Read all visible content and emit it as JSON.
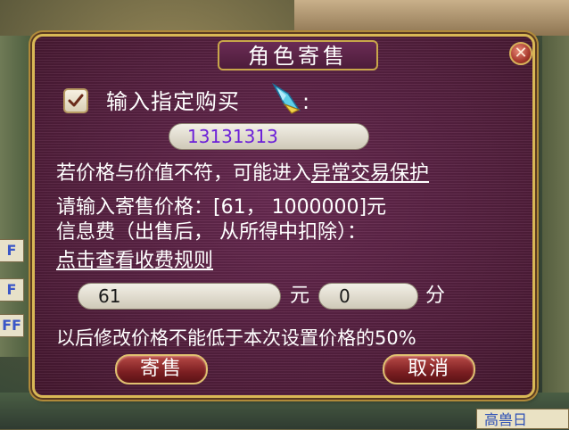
{
  "dialog": {
    "title": "角色寄售",
    "close_glyph": "✕",
    "buyer_checkbox_checked": true,
    "buyer_label": "输入指定购买",
    "buyer_colon": ":",
    "buyer_id": "13131313",
    "warning_prefix": "若价格与价值不符，可能进入",
    "warning_link": "异常交易保护",
    "price_range": "请输入寄售价格：[61， 1000000]元",
    "fee_text": "信息费（出售后， 从所得中扣除）：",
    "fee_rule_link": "点击查看收费规则",
    "price_yuan": "61",
    "unit_yuan": "元",
    "price_fen": "0",
    "unit_fen": "分",
    "note": "以后修改价格不能低于本次设置价格的50%",
    "sell_button": "寄售",
    "cancel_button": "取消"
  },
  "background": {
    "side_tags": [
      "F",
      "F",
      "FF"
    ],
    "bottom_tag": "高兽日"
  },
  "colors": {
    "panel": "#55203f",
    "border_gold": "#d9b855",
    "buyer_id_text": "#6b1fd8",
    "button_red": "#7c1f22"
  },
  "icons": {
    "checkbox": "check-icon",
    "close": "close-icon",
    "crystal": "crystal-icon"
  }
}
